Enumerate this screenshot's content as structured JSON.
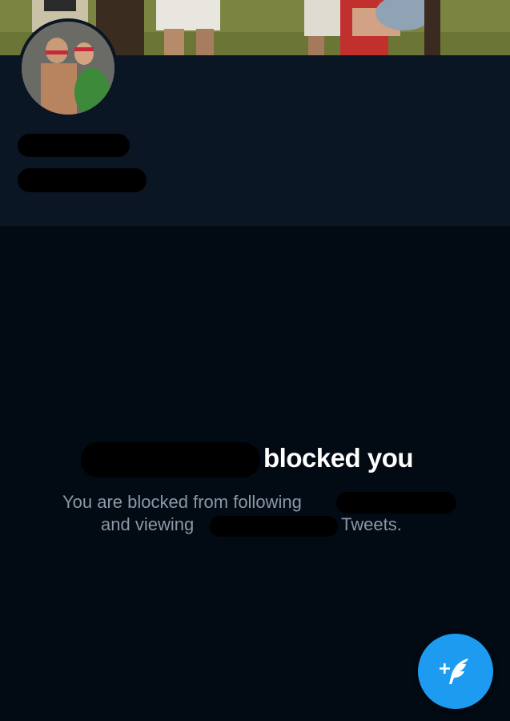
{
  "profile": {
    "banner_icon": "banner-photo",
    "avatar_icon": "avatar-photo"
  },
  "blocked": {
    "title_suffix": "blocked you",
    "line1": "You are blocked from following",
    "line2_prefix": "and viewing",
    "line2_suffix": "Tweets."
  },
  "fab": {
    "icon": "compose-tweet-icon",
    "color": "#1d9bf0"
  },
  "colors": {
    "background": "#020a13",
    "header": "#0a1623",
    "title": "#ffffff",
    "body_text": "#8a98a7"
  }
}
